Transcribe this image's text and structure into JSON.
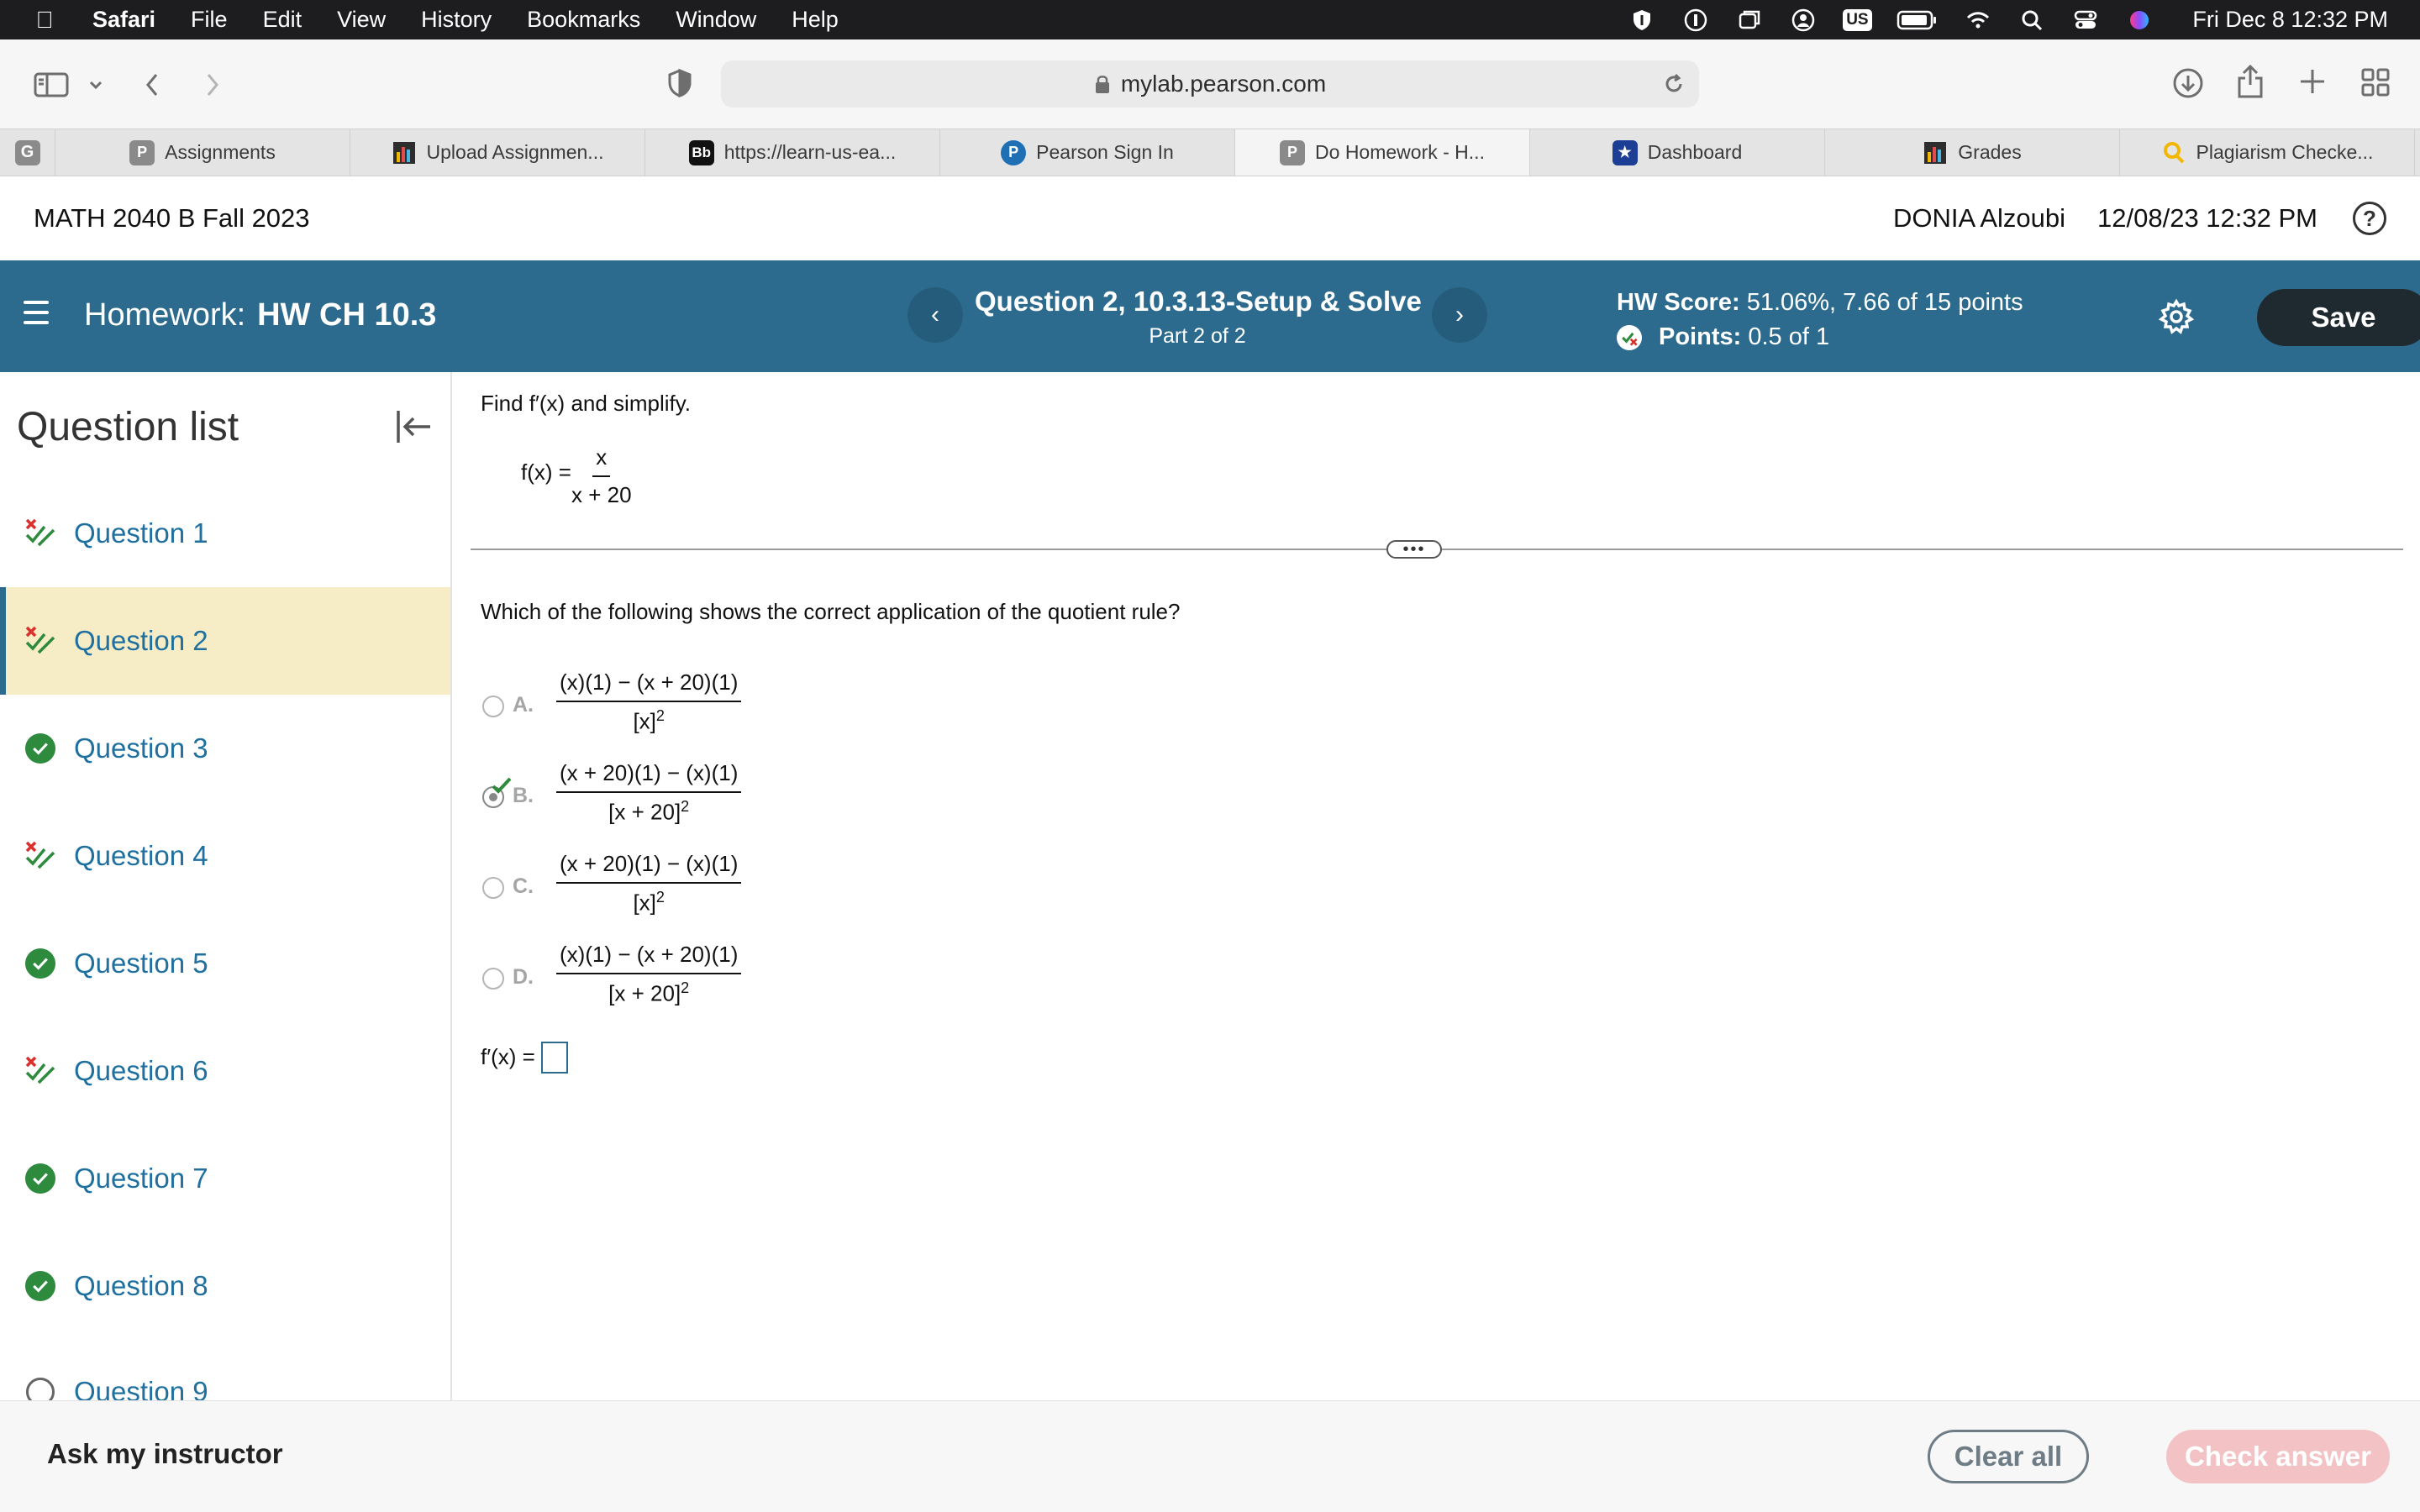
{
  "menubar": {
    "app": "Safari",
    "menus": [
      "File",
      "Edit",
      "View",
      "History",
      "Bookmarks",
      "Window",
      "Help"
    ],
    "status_icons": [
      "shield-icon",
      "one-password-icon",
      "window-icon",
      "user-circle-icon",
      "keyboard-us-badge",
      "battery-icon",
      "wifi-icon",
      "search-icon",
      "control-center-icon",
      "siri-icon"
    ],
    "keyboard_label": "US",
    "clock": "Fri Dec 8  12:32 PM"
  },
  "browser": {
    "url": "mylab.pearson.com",
    "pinned_tab_label": "G",
    "tabs": [
      {
        "label": "Assignments",
        "icon": "P",
        "color": "#8a8a8a"
      },
      {
        "label": "Upload Assignmen...",
        "icon": "chart",
        "color": "#2d2d2d"
      },
      {
        "label": "https://learn-us-ea...",
        "icon": "Bb",
        "color": "#111111"
      },
      {
        "label": "Pearson Sign In",
        "icon": "P",
        "color": "#1f6fb5"
      },
      {
        "label": "Do Homework - H...",
        "icon": "P",
        "color": "#8a8a8a"
      },
      {
        "label": "Dashboard",
        "icon": "★",
        "color": "#1c3f95"
      },
      {
        "label": "Grades",
        "icon": "chart",
        "color": "#2d2d2d"
      },
      {
        "label": "Plagiarism Checke...",
        "icon": "magnifier",
        "color": "#f2b705"
      }
    ],
    "active_tab_index": 4
  },
  "course": {
    "title": "MATH 2040 B Fall 2023",
    "user": "DONIA Alzoubi",
    "datetime": "12/08/23 12:32 PM",
    "help_label": "?"
  },
  "hw": {
    "label": "Homework:",
    "name": "HW CH 10.3",
    "question_title": "Question 2, 10.3.13-Setup & Solve",
    "part": "Part 2 of 2",
    "score_label": "HW Score:",
    "score_value": "51.06%, 7.66 of 15 points",
    "points_label": "Points:",
    "points_value": "0.5 of 1",
    "save_label": "Save",
    "prev_glyph": "‹",
    "next_glyph": "›"
  },
  "sidebar": {
    "title": "Question list",
    "items": [
      {
        "label": "Question 1",
        "status": "partial"
      },
      {
        "label": "Question 2",
        "status": "partial"
      },
      {
        "label": "Question 3",
        "status": "correct"
      },
      {
        "label": "Question 4",
        "status": "partial"
      },
      {
        "label": "Question 5",
        "status": "correct"
      },
      {
        "label": "Question 6",
        "status": "partial"
      },
      {
        "label": "Question 7",
        "status": "correct"
      },
      {
        "label": "Question 8",
        "status": "correct"
      },
      {
        "label": "Question 9",
        "status": "unanswered"
      }
    ],
    "active_index": 1
  },
  "problem": {
    "instruction": "Find f′(x) and simplify.",
    "function_lhs": "f(x) =",
    "function_num": "x",
    "function_den": "x + 20",
    "handle_glyph": "•••",
    "prompt": "Which of the following shows the correct application of the quotient rule?",
    "choices": [
      {
        "letter": "A.",
        "num": "(x)(1) − (x + 20)(1)",
        "den_base": "[x]",
        "den_exp": "2"
      },
      {
        "letter": "B.",
        "num": "(x + 20)(1) − (x)(1)",
        "den_base": "[x + 20]",
        "den_exp": "2"
      },
      {
        "letter": "C.",
        "num": "(x + 20)(1) − (x)(1)",
        "den_base": "[x]",
        "den_exp": "2"
      },
      {
        "letter": "D.",
        "num": "(x)(1) − (x + 20)(1)",
        "den_base": "[x + 20]",
        "den_exp": "2"
      }
    ],
    "selected_choice": "B.",
    "answer_label": "f′(x) =",
    "answer_value": ""
  },
  "footer": {
    "ask": "Ask my instructor",
    "clear_all": "Clear all",
    "check_answer": "Check answer"
  },
  "colors": {
    "hw_bar": "#2c6b8e",
    "link_blue": "#1f6f9f",
    "active_question_bg": "#f6ecc6",
    "correct_green": "#2e8a3d",
    "partial_red": "#d9302c",
    "check_answer_disabled": "#f2c2c4"
  }
}
